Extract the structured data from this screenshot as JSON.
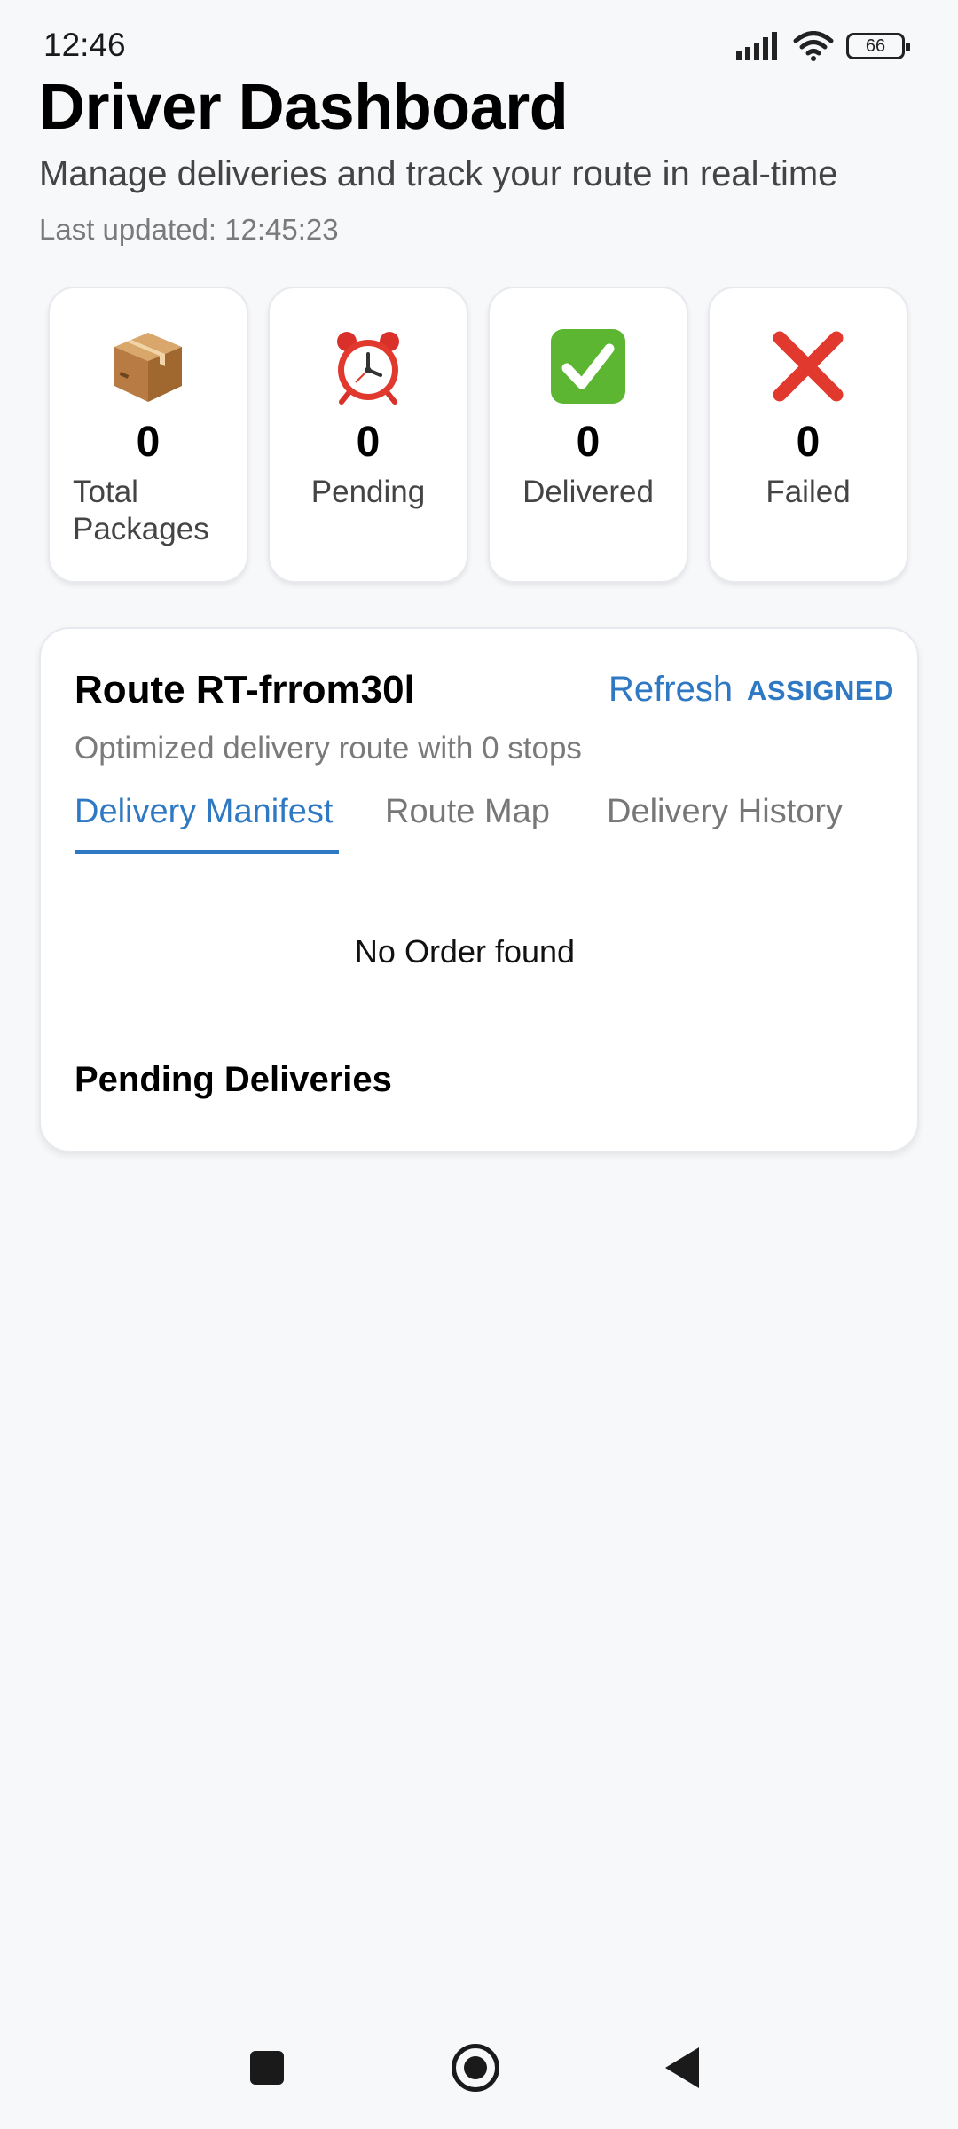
{
  "status_bar": {
    "time": "12:46",
    "battery": "66"
  },
  "header": {
    "title": "Driver Dashboard",
    "subtitle": "Manage deliveries and track your route in real-time",
    "last_updated": "Last updated: 12:45:23"
  },
  "stats": [
    {
      "icon": "package-icon",
      "value": "0",
      "label": "Total Packages"
    },
    {
      "icon": "alarm-clock-icon",
      "value": "0",
      "label": "Pending"
    },
    {
      "icon": "check-mark-icon",
      "value": "0",
      "label": "Delivered"
    },
    {
      "icon": "cross-mark-icon",
      "value": "0",
      "label": "Failed"
    }
  ],
  "route": {
    "title": "Route RT-frrom30l",
    "refresh_label": "Refresh",
    "status": "ASSIGNED",
    "description": "Optimized delivery route with 0 stops",
    "tabs": [
      {
        "label": "Delivery Manifest",
        "active": true
      },
      {
        "label": "Route Map",
        "active": false
      },
      {
        "label": "Delivery History",
        "active": false
      }
    ],
    "empty_message": "No Order found",
    "section_heading": "Pending Deliveries"
  },
  "colors": {
    "accent": "#2f78c4",
    "background": "#f7f8fa",
    "muted_text": "#7a7a7a"
  }
}
